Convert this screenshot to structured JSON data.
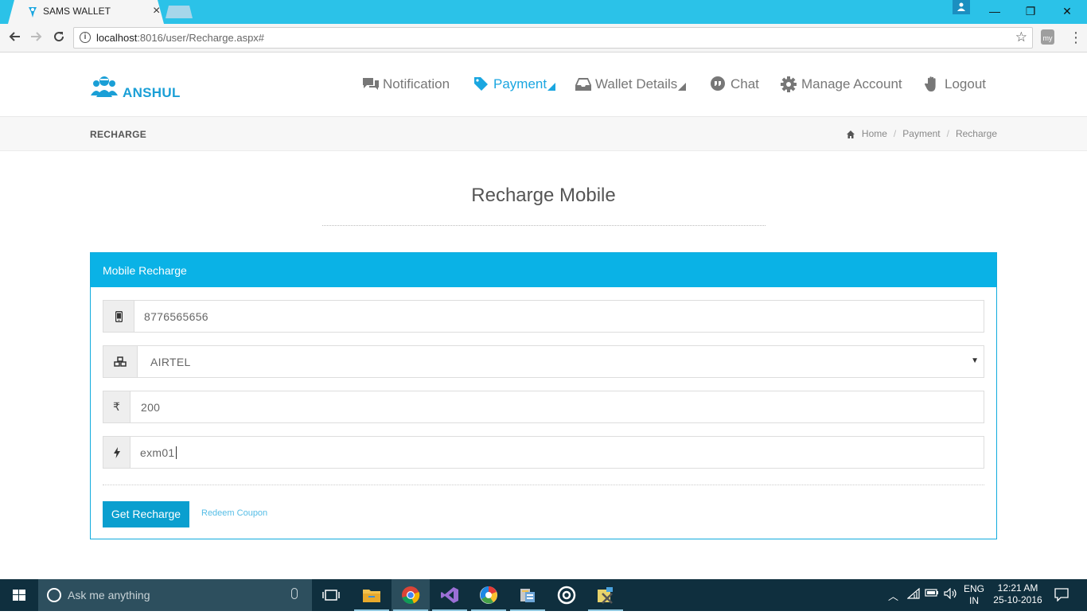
{
  "browser": {
    "tab_title": "SAMS WALLET",
    "tab_close": "×",
    "url_host": "localhost",
    "url_path": ":8016/user/Recharge.aspx#",
    "ext_label": "my",
    "controls": {
      "minimize": "—",
      "maximize": "❐",
      "close": "✕"
    }
  },
  "header": {
    "brand": "ANSHUL",
    "menu": [
      {
        "label": "Notification",
        "icon": "chat-bubbles-icon"
      },
      {
        "label": "Payment",
        "icon": "tag-icon",
        "active": true,
        "dropdown": true
      },
      {
        "label": "Wallet Details",
        "icon": "inbox-icon",
        "dropdown": true
      },
      {
        "label": "Chat",
        "icon": "chat-icon"
      },
      {
        "label": "Manage Account",
        "icon": "gear-icon"
      },
      {
        "label": "Logout",
        "icon": "hand-icon"
      }
    ]
  },
  "crumbbar": {
    "title": "RECHARGE",
    "crumbs": [
      "Home",
      "Payment",
      "Recharge"
    ],
    "sep": "/"
  },
  "page": {
    "title": "Recharge Mobile"
  },
  "panel": {
    "heading": "Mobile Recharge",
    "fields": {
      "mobile": {
        "icon": "mobile-icon",
        "value": "8776565656"
      },
      "operator": {
        "icon": "cubes-icon",
        "selected": "AIRTEL"
      },
      "amount": {
        "icon": "rupee-icon",
        "glyph": "₹",
        "value": "200"
      },
      "coupon": {
        "icon": "bolt-icon",
        "value": "exm01"
      }
    },
    "submit_label": "Get Recharge",
    "redeem_label": "Redeem Coupon"
  },
  "taskbar": {
    "search_placeholder": "Ask me anything",
    "lang_top": "ENG",
    "lang_bottom": "IN",
    "time": "12:21 AM",
    "date": "25-10-2016"
  },
  "colors": {
    "accent": "#0ab2e6",
    "brand": "#1a9fd6",
    "titlebar": "#2bc2e8",
    "taskbar": "#0f2f3e"
  }
}
